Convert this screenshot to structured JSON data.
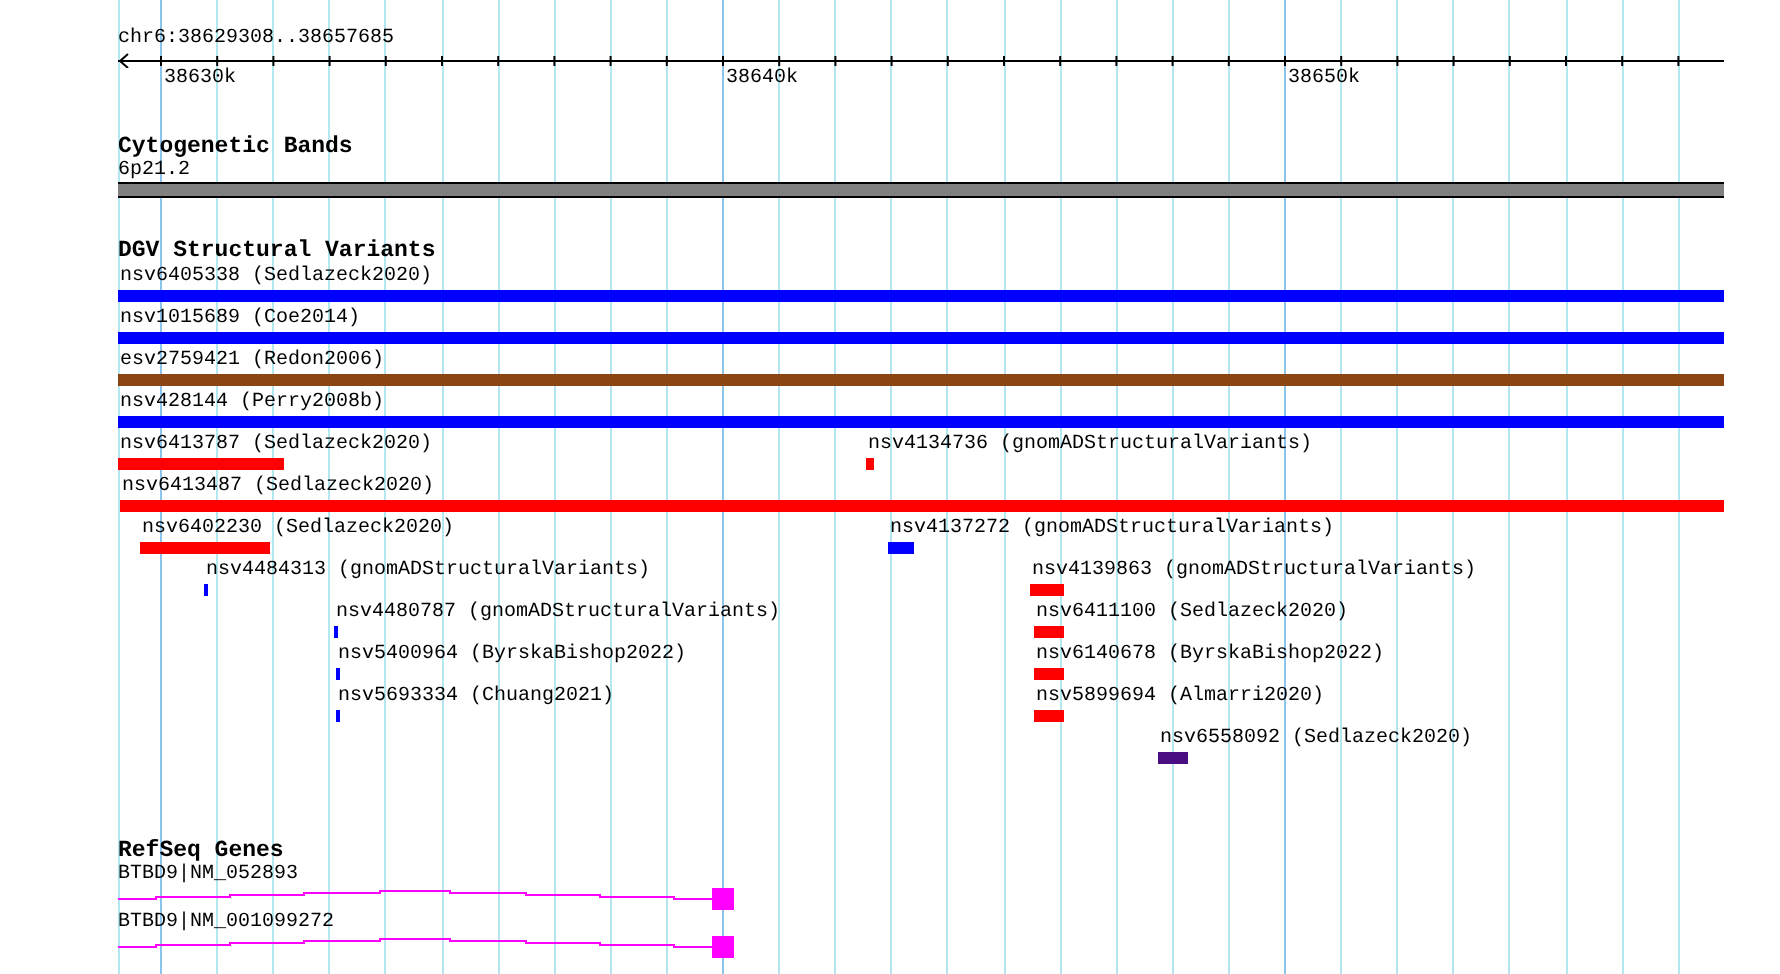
{
  "ruler": {
    "region": "chr6:38629308..38657685",
    "ticks": [
      "38630k",
      "38640k",
      "38650k"
    ]
  },
  "cytoband_track": {
    "title": "Cytogenetic Bands",
    "bands": [
      {
        "label": "6p21.2"
      }
    ]
  },
  "dgv_track": {
    "title": "DGV Structural Variants",
    "features": [
      {
        "label": "nsv6405338 (Sedlazeck2020)",
        "color": "#0000ff"
      },
      {
        "label": "nsv1015689 (Coe2014)",
        "color": "#0000ff"
      },
      {
        "label": "esv2759421 (Redon2006)",
        "color": "#8b4513"
      },
      {
        "label": "nsv428144 (Perry2008b)",
        "color": "#0000ff"
      },
      {
        "label": "nsv6413787 (Sedlazeck2020)",
        "color": "#ff0000"
      },
      {
        "label": "nsv4134736 (gnomADStructuralVariants)",
        "color": "#ff0000"
      },
      {
        "label": "nsv6413487 (Sedlazeck2020)",
        "color": "#ff0000"
      },
      {
        "label": "nsv6402230 (Sedlazeck2020)",
        "color": "#ff0000"
      },
      {
        "label": "nsv4137272 (gnomADStructuralVariants)",
        "color": "#0000ff"
      },
      {
        "label": "nsv4484313 (gnomADStructuralVariants)",
        "color": "#0000ff"
      },
      {
        "label": "nsv4139863 (gnomADStructuralVariants)",
        "color": "#ff0000"
      },
      {
        "label": "nsv4480787 (gnomADStructuralVariants)",
        "color": "#0000ff"
      },
      {
        "label": "nsv6411100 (Sedlazeck2020)",
        "color": "#ff0000"
      },
      {
        "label": "nsv5400964 (ByrskaBishop2022)",
        "color": "#0000ff"
      },
      {
        "label": "nsv6140678 (ByrskaBishop2022)",
        "color": "#ff0000"
      },
      {
        "label": "nsv5693334 (Chuang2021)",
        "color": "#0000ff"
      },
      {
        "label": "nsv5899694 (Almarri2020)",
        "color": "#ff0000"
      },
      {
        "label": "nsv6558092 (Sedlazeck2020)",
        "color": "#4b0e82"
      }
    ]
  },
  "refseq_track": {
    "title": "RefSeq Genes",
    "genes": [
      {
        "label": "BTBD9|NM_052893"
      },
      {
        "label": "BTBD9|NM_001099272"
      }
    ]
  }
}
